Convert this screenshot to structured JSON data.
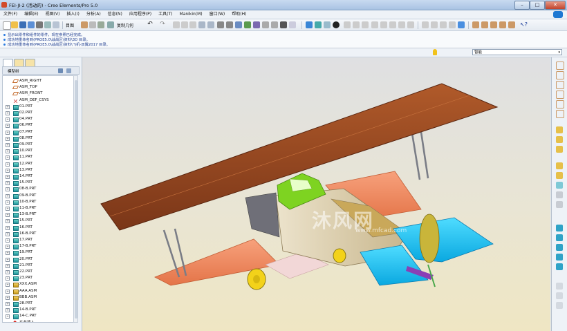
{
  "window": {
    "title": "FEI-JI-2 (活动的) - Creo Elements/Pro 5.0",
    "controls": [
      "–",
      "□",
      "✕"
    ]
  },
  "menubar": {
    "items": [
      "文件(F)",
      "编辑(E)",
      "视图(V)",
      "插入(I)",
      "分析(A)",
      "信息(N)",
      "应用程序(P)",
      "工具(T)",
      "Manikin(M)",
      "窗口(W)",
      "帮助(H)"
    ]
  },
  "toolbar": {
    "retrieve_label": "目图",
    "copy_geom_label": "复制几何",
    "accent": "#2a6fc9"
  },
  "messages": [
    "显示出零件和组件的零件，现在参照已经完成。",
    "成功地重命名到(PROE5.0\\战战区\\资料\\3D 目录。",
    "成功地重命名到(PROE5.0\\战战区\\资料\\飞机-双翼2017 目录。"
  ],
  "status": {
    "filter_value": "智能",
    "filter_arrow": "▾"
  },
  "model_tree": {
    "header": "模型树",
    "items": [
      {
        "label": "ASM_RIGHT",
        "icon": "datum-plane-icon",
        "expand": ""
      },
      {
        "label": "ASM_TOP",
        "icon": "datum-plane-icon",
        "expand": ""
      },
      {
        "label": "ASM_FRONT",
        "icon": "datum-plane-icon",
        "expand": ""
      },
      {
        "label": "ASM_DEF_CSYS",
        "icon": "csys-icon",
        "expand": ""
      },
      {
        "label": "01.PRT",
        "icon": "part-icon",
        "expand": "+"
      },
      {
        "label": "02.PRT",
        "icon": "part-icon",
        "expand": "+"
      },
      {
        "label": "04.PRT",
        "icon": "part-icon",
        "expand": "+"
      },
      {
        "label": "06.PRT",
        "icon": "part-icon",
        "expand": "+"
      },
      {
        "label": "07.PRT",
        "icon": "part-icon",
        "expand": "+"
      },
      {
        "label": "08.PRT",
        "icon": "part-icon",
        "expand": "+"
      },
      {
        "label": "09.PRT",
        "icon": "part-icon",
        "expand": "+"
      },
      {
        "label": "10.PRT",
        "icon": "part-icon",
        "expand": "+"
      },
      {
        "label": "11.PRT",
        "icon": "part-icon",
        "expand": "+"
      },
      {
        "label": "12.PRT",
        "icon": "part-icon",
        "expand": "+"
      },
      {
        "label": "13.PRT",
        "icon": "part-icon",
        "expand": "+"
      },
      {
        "label": "14.PRT",
        "icon": "part-icon",
        "expand": "+"
      },
      {
        "label": "15.PRT",
        "icon": "part-icon",
        "expand": "+"
      },
      {
        "label": "08-B.PRT",
        "icon": "part-icon",
        "expand": "+"
      },
      {
        "label": "09-B.PRT",
        "icon": "part-icon",
        "expand": "+"
      },
      {
        "label": "10-B.PRT",
        "icon": "part-icon",
        "expand": "+"
      },
      {
        "label": "11-B.PRT",
        "icon": "part-icon",
        "expand": "+"
      },
      {
        "label": "13-B.PRT",
        "icon": "part-icon",
        "expand": "+"
      },
      {
        "label": "15.PRT",
        "icon": "part-icon",
        "expand": "+"
      },
      {
        "label": "16.PRT",
        "icon": "part-icon",
        "expand": "+"
      },
      {
        "label": "16-B.PRT",
        "icon": "part-icon",
        "expand": "+"
      },
      {
        "label": "17.PRT",
        "icon": "part-icon",
        "expand": "+"
      },
      {
        "label": "17-B.PRT",
        "icon": "part-icon",
        "expand": "+"
      },
      {
        "label": "19.PRT",
        "icon": "part-icon",
        "expand": "+"
      },
      {
        "label": "20.PRT",
        "icon": "part-icon",
        "expand": "+"
      },
      {
        "label": "21.PRT",
        "icon": "part-icon",
        "expand": "+"
      },
      {
        "label": "22.PRT",
        "icon": "part-icon",
        "expand": "+"
      },
      {
        "label": "23.PRT",
        "icon": "part-icon",
        "expand": "+"
      },
      {
        "label": "XXX.ASM",
        "icon": "assembly-icon",
        "expand": "+"
      },
      {
        "label": "AAA.ASM",
        "icon": "assembly-icon",
        "expand": "+"
      },
      {
        "label": "BBB.ASM",
        "icon": "assembly-icon",
        "expand": "+"
      },
      {
        "label": "28.PRT",
        "icon": "part-icon",
        "expand": "+"
      },
      {
        "label": "14-B.PRT",
        "icon": "part-icon",
        "expand": "+"
      },
      {
        "label": "14-C.PRT",
        "icon": "part-icon",
        "expand": "+"
      },
      {
        "label": "在此插入",
        "icon": "insert-here-icon",
        "expand": ""
      }
    ]
  },
  "viewport": {
    "watermark": "沐风网",
    "watermark_url": "www.mfcad.com",
    "colors": {
      "upper_wing": "#9a4a22",
      "lower_wing": "#f08a62",
      "tail": "#18c8f0",
      "cockpit": "#7ed321",
      "wheel": "#f3d21a",
      "fuselage": "#d9c9a3"
    }
  }
}
